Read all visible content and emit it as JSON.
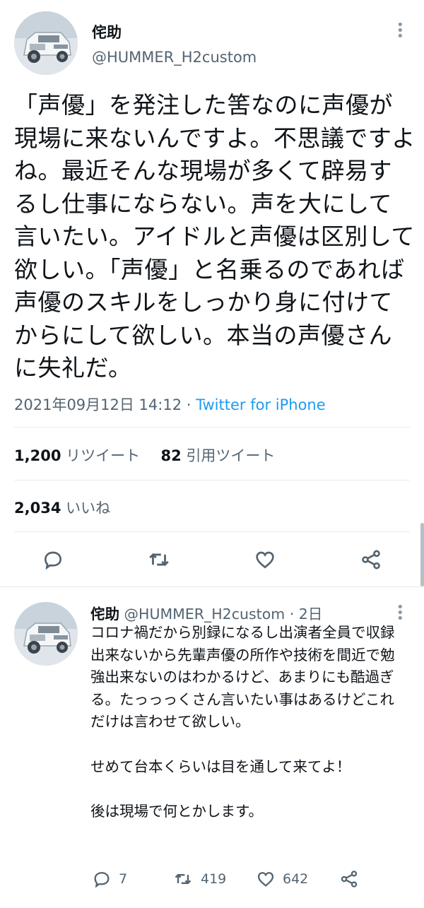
{
  "tweet": {
    "author_name": "侘助",
    "author_handle": "@HUMMER_H2custom",
    "text": "「声優」を発注した筈なのに声優が現場に来ないんですよ。不思議ですよね。最近そんな現場が多くて辟易するし仕事にならない。声を大にして言いたい。アイドルと声優は区別して欲しい。「声優」と名乗るのであれば声優のスキルをしっかり身に付けてからにして欲しい。本当の声優さんに失礼だ。",
    "timestamp": "2021年09月12日 14:12",
    "separator": "·",
    "source": "Twitter for iPhone",
    "retweets_count": "1,200",
    "retweets_label": "リツイート",
    "quotes_count": "82",
    "quotes_label": "引用ツイート",
    "likes_count": "2,034",
    "likes_label": "いいね"
  },
  "reply": {
    "author_name": "侘助",
    "author_handle": "@HUMMER_H2custom",
    "age": "· 2日",
    "text": "コロナ禍だから別録になるし出演者全員で収録出来ないから先輩声優の所作や技術を間近で勉強出来ないのはわかるけど、あまりにも酷過ぎる。たっっっくさん言いたい事はあるけどこれだけは言わせて欲しい。\n\nせめて台本くらいは目を通して来てよ！\n\n後は現場で何とかします。",
    "reply_count": "7",
    "retweet_count": "419",
    "like_count": "642"
  },
  "icons": {
    "more": "more-vertical-icon",
    "reply": "reply-icon",
    "retweet": "retweet-icon",
    "like": "heart-icon",
    "share": "share-icon"
  },
  "colors": {
    "accent": "#1d9bf0",
    "secondary_text": "#536471",
    "divider": "#e6eaed"
  }
}
